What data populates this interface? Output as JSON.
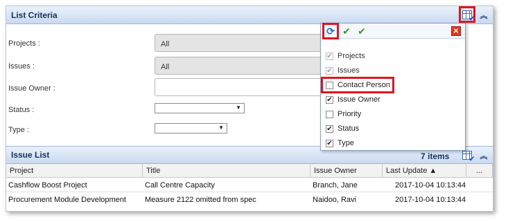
{
  "criteria": {
    "title": "List Criteria",
    "projects_label": "Projects :",
    "projects_value": "All",
    "issues_label": "Issues :",
    "issues_value": "All",
    "owner_label": "Issue Owner :",
    "owner_value": "",
    "status_label": "Status :",
    "type_label": "Type :"
  },
  "popup": {
    "options": [
      {
        "label": "Projects",
        "checked": true,
        "disabled": true
      },
      {
        "label": "Issues",
        "checked": true,
        "disabled": true
      },
      {
        "label": "Contact Person",
        "checked": false,
        "disabled": false
      },
      {
        "label": "Issue Owner",
        "checked": true,
        "disabled": false
      },
      {
        "label": "Priority",
        "checked": false,
        "disabled": false
      },
      {
        "label": "Status",
        "checked": true,
        "disabled": false
      },
      {
        "label": "Type",
        "checked": true,
        "disabled": false
      }
    ]
  },
  "issues": {
    "title": "Issue List",
    "count": "7 items",
    "columns": [
      "Project",
      "Title",
      "Issue Owner",
      "Last Update ▲",
      "..."
    ],
    "rows": [
      {
        "project": "Cashflow Boost Project",
        "title": "Call Centre Capacity",
        "owner": "Branch, Jane",
        "updated": "2017-10-04 10:13:44"
      },
      {
        "project": "Procurement Module Development",
        "title": "Measure 2122 omitted from spec",
        "owner": "Naidoo, Ravi",
        "updated": "2017-10-04 10:13:44"
      }
    ]
  },
  "colors": {
    "highlight": "#e0141e",
    "header": "#c9daf1"
  }
}
